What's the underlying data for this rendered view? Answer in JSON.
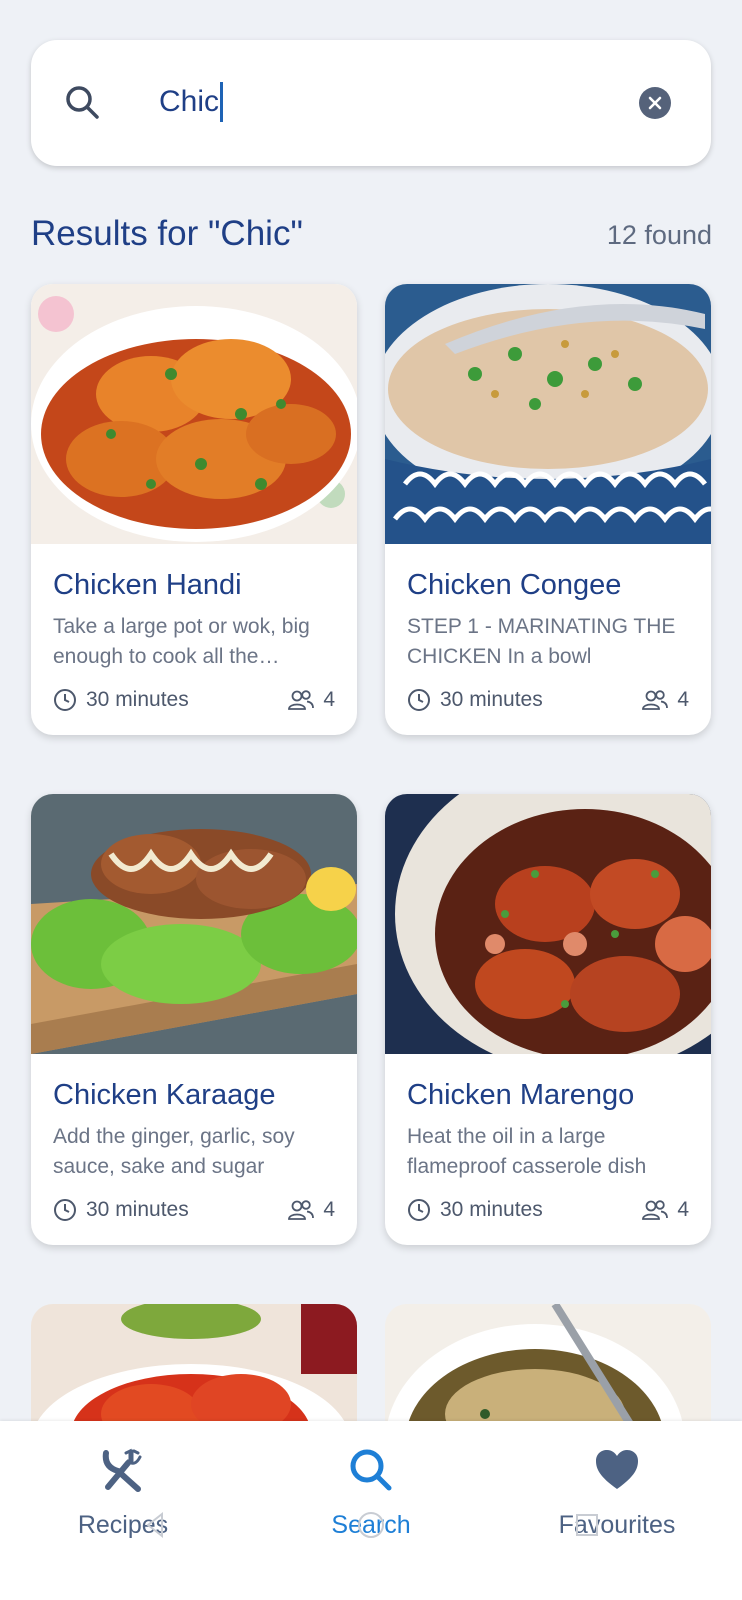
{
  "search": {
    "value": "Chic"
  },
  "results": {
    "title": "Results for \"Chic\"",
    "count": "12 found"
  },
  "cards": [
    {
      "title": "Chicken Handi",
      "description": "Take a large pot or wok, big enough to cook all the chicken",
      "time": "30 minutes",
      "servings": "4"
    },
    {
      "title": "Chicken Congee",
      "description": "STEP 1 - MARINATING THE CHICKEN In a bowl",
      "time": "30 minutes",
      "servings": "4"
    },
    {
      "title": "Chicken Karaage",
      "description": "Add the ginger, garlic, soy sauce, sake and sugar",
      "time": "30 minutes",
      "servings": "4"
    },
    {
      "title": "Chicken Marengo",
      "description": "Heat the oil in a large flameproof casserole dish",
      "time": "30 minutes",
      "servings": "4"
    }
  ],
  "nav": {
    "items": [
      {
        "label": "Recipes",
        "icon": "fork-knife-icon"
      },
      {
        "label": "Search",
        "icon": "search-icon",
        "active": true
      },
      {
        "label": "Favourites",
        "icon": "heart-icon"
      }
    ]
  },
  "colors": {
    "accent": "#1e7fd6",
    "primary_text": "#1f3f86",
    "nav_inactive": "#4d6283",
    "background": "#eef1f6"
  }
}
